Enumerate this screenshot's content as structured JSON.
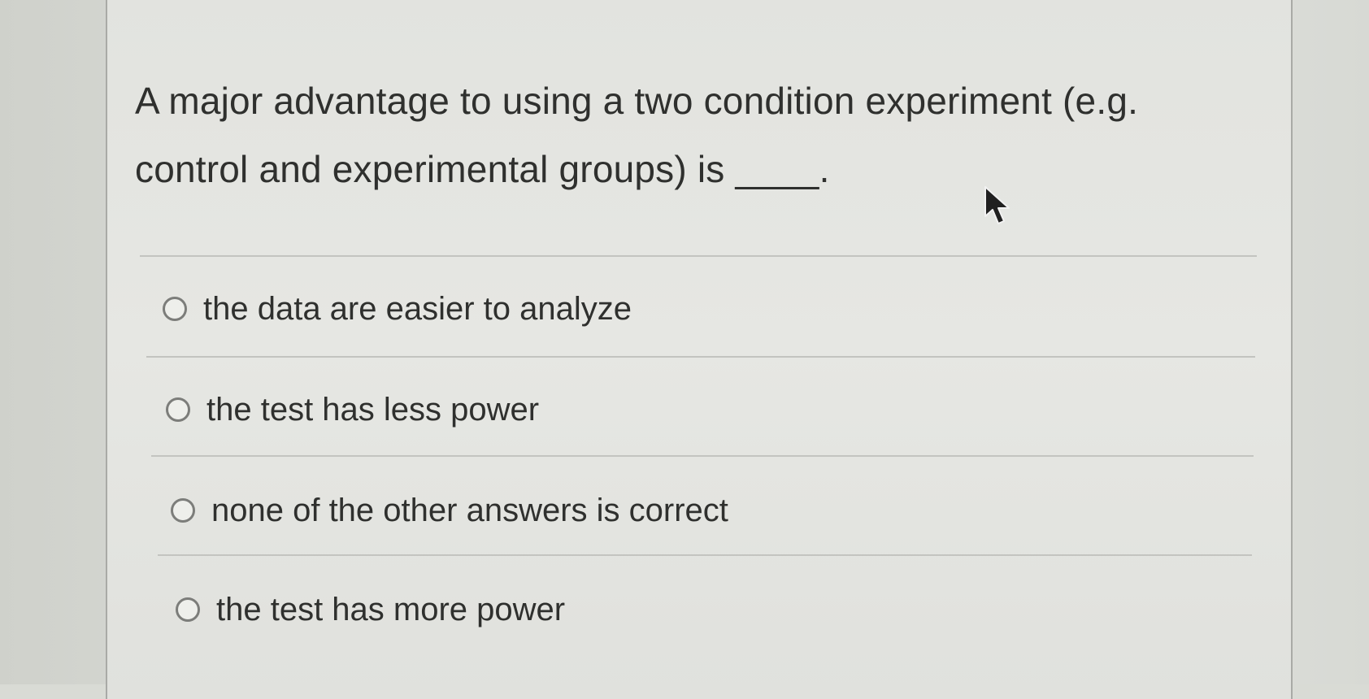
{
  "question": {
    "text": "A major advantage to using a two condition experiment (e.g. control and experimental groups) is ____."
  },
  "answers": [
    {
      "label": "the data are easier to analyze",
      "selected": false
    },
    {
      "label": "the test has less power",
      "selected": false
    },
    {
      "label": "none of the other answers is correct",
      "selected": false
    },
    {
      "label": "the test has more power",
      "selected": false
    }
  ],
  "icons": {
    "radio": "radio-button-icon",
    "cursor": "mouse-pointer-icon"
  }
}
